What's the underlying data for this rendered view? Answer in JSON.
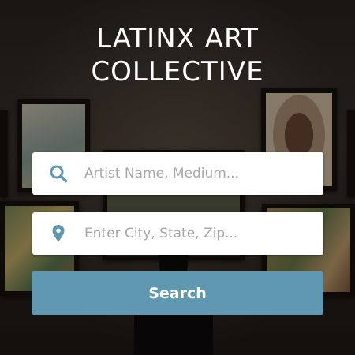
{
  "hero": {
    "title_line1": "LATINX ART",
    "title_line2": "COLLECTIVE"
  },
  "search": {
    "artist_placeholder": "Artist Name, Medium...",
    "location_placeholder": "Enter City, State, Zip...",
    "button_label": "Search"
  },
  "colors": {
    "accent": "#5f98b0",
    "icon": "#5f98b0",
    "placeholder": "#a7a7a7",
    "title": "#ffffff"
  },
  "icons": {
    "artist_field": "search-icon",
    "location_field": "map-pin-icon"
  }
}
